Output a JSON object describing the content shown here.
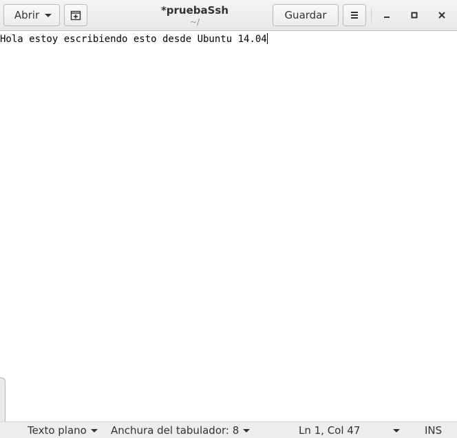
{
  "header": {
    "open_label": "Abrir",
    "title": "*pruebaSsh",
    "subtitle": "~/",
    "save_label": "Guardar",
    "icons": {
      "new_tab": "new-document-icon",
      "menu": "hamburger-menu-icon",
      "minimize": "minimize-icon",
      "maximize": "maximize-icon",
      "close": "close-icon"
    }
  },
  "editor": {
    "content": "Hola estoy escribiendo esto desde Ubuntu 14.04"
  },
  "statusbar": {
    "language": "Texto plano",
    "tab_width": "Anchura del tabulador: 8",
    "position": "Ln 1, Col 47",
    "mode": "INS"
  }
}
